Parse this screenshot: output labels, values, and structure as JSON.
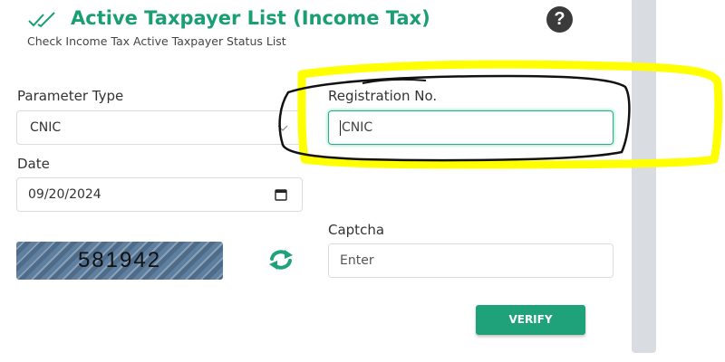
{
  "header": {
    "title": "Active Taxpayer List (Income Tax)",
    "subtitle": "Check Income Tax Active Taxpayer Status List",
    "help_glyph": "?"
  },
  "form": {
    "parameter_type": {
      "label": "Parameter Type",
      "value": "CNIC"
    },
    "registration_no": {
      "label": "Registration No.",
      "value": "CNIC"
    },
    "date": {
      "label": "Date",
      "value": "09/20/2024"
    },
    "captcha": {
      "label": "Captcha",
      "image_text": "581942",
      "input_value": "Enter"
    }
  },
  "actions": {
    "verify_label": "VERIFY"
  },
  "icons": {
    "header_check": "double-check-icon",
    "help": "question-circle-icon",
    "select": "chevron-down-icon",
    "date": "calendar-icon",
    "refresh": "refresh-icon"
  },
  "colors": {
    "accent": "#1fa27a",
    "title": "#1a9e73",
    "highlight": "#ffff00",
    "circle_annotation": "#111111",
    "side_panel": "#d9dde1"
  }
}
